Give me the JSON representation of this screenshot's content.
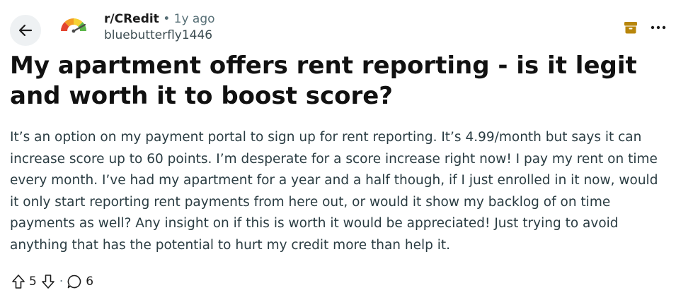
{
  "header": {
    "subreddit": "r/CRedit",
    "separator": "•",
    "age": "1y ago",
    "author": "bluebutterfly1446"
  },
  "post": {
    "title": "My apartment offers rent reporting - is it legit and worth it to boost score?",
    "body": "It’s an option on my payment portal to sign up for rent reporting. It’s 4.99/month but says it can increase score up to 60 points. I’m desperate for a score increase right now! I pay my rent on time every month. I’ve had my apartment for a year and a half though, if I just enrolled in it now, would it only start reporting rent payments from here out, or would it show my backlog of on time payments as well? Any insight on if this is worth it would be appreciated! Just trying to avoid anything that has the potential to hurt my credit more than help it."
  },
  "actions": {
    "score": "5",
    "separator": "·",
    "comments": "6"
  },
  "icons": {
    "back": "arrow-left-icon",
    "avatar": "credit-gauge-icon",
    "archive": "archive-icon",
    "more": "more-horizontal-icon",
    "upvote": "upvote-arrow-icon",
    "downvote": "downvote-arrow-icon",
    "comment": "comment-bubble-icon"
  },
  "colors": {
    "archive_icon": "#b8860b",
    "back_button_bg": "#eef1f3",
    "title": "#111111",
    "body": "#2a3c42"
  }
}
